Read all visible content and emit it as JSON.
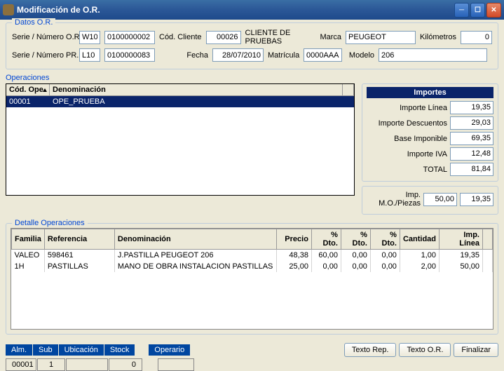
{
  "window": {
    "title": "Modificación de O.R."
  },
  "datos": {
    "legend": "Datos O.R.",
    "serie_or_label": "Serie / Número O.R.",
    "serie_or_serie": "W10",
    "serie_or_num": "0100000002",
    "serie_pr_label": "Serie / Número PR.",
    "serie_pr_serie": "L10",
    "serie_pr_num": "0100000083",
    "cod_cliente_label": "Cód. Cliente",
    "cod_cliente": "00026",
    "cliente_nombre": "CLIENTE DE PRUEBAS",
    "fecha_label": "Fecha",
    "fecha": "28/07/2010",
    "matricula_label": "Matrícula",
    "matricula": "0000AAA",
    "marca_label": "Marca",
    "marca": "PEUGEOT",
    "modelo_label": "Modelo",
    "modelo": "206",
    "km_label": "Kilómetros",
    "km": "0"
  },
  "operaciones": {
    "label": "Operaciones",
    "col_cod": "Cód. Ope.",
    "col_den": "Denominación",
    "rows": [
      {
        "cod": "00001",
        "den": "OPE_PRUEBA"
      }
    ]
  },
  "importes": {
    "header": "Importes",
    "linea_label": "Importe Línea",
    "linea": "19,35",
    "desc_label": "Importe Descuentos",
    "desc": "29,03",
    "base_label": "Base Imponible",
    "base": "69,35",
    "iva_label": "Importe IVA",
    "iva": "12,48",
    "total_label": "TOTAL",
    "total": "81,84",
    "mo_label": "Imp. M.O./Piezas",
    "mo": "50,00",
    "piezas": "19,35"
  },
  "detalle": {
    "label": "Detalle Operaciones",
    "cols": {
      "familia": "Familia",
      "ref": "Referencia",
      "den": "Denominación",
      "precio": "Precio",
      "dto1": "% Dto.",
      "dto2": "% Dto.",
      "dto3": "% Dto.",
      "cant": "Cantidad",
      "imp": "Imp. Línea"
    },
    "rows": [
      {
        "familia": "VALEO",
        "ref": "598461",
        "den": "J.PASTILLA PEUGEOT 206",
        "precio": "48,38",
        "dto1": "60,00",
        "dto2": "0,00",
        "dto3": "0,00",
        "cant": "1,00",
        "imp": "19,35"
      },
      {
        "familia": "1H",
        "ref": "PASTILLAS",
        "den": "MANO DE OBRA INSTALACION PASTILLAS",
        "precio": "25,00",
        "dto1": "0,00",
        "dto2": "0,00",
        "dto3": "0,00",
        "cant": "2,00",
        "imp": "50,00"
      }
    ]
  },
  "footer": {
    "tabs": [
      "Alm.",
      "Sub",
      "Ubicación",
      "Stock"
    ],
    "operario_label": "Operario",
    "alm": "00001",
    "sub": "1",
    "ubic": "",
    "stock": "0",
    "operario": "",
    "btn_rep": "Texto Rep.",
    "btn_or": "Texto O.R.",
    "btn_fin": "Finalizar"
  },
  "chart_data": null
}
